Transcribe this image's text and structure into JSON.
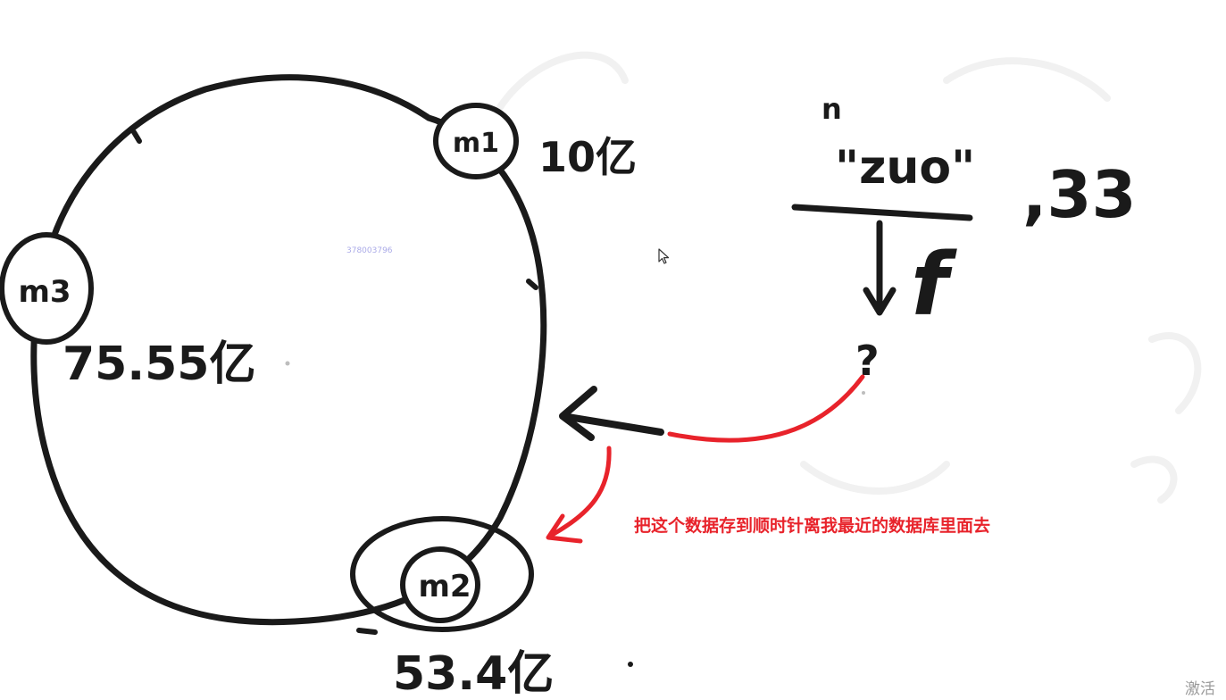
{
  "ring": {
    "nodes": [
      {
        "id": "m1",
        "label": "m1",
        "position_label": "10亿"
      },
      {
        "id": "m2",
        "label": "m2",
        "position_label": "53.4亿"
      },
      {
        "id": "m3",
        "label": "m3",
        "position_label": "75.55亿"
      }
    ]
  },
  "key": {
    "numerator": "\"zuo\"",
    "denominator": "f",
    "exponent": "n",
    "suffix": ",33",
    "result": "?"
  },
  "annotation": {
    "text": "把这个数据存到顺时针离我最近的数据库里面去",
    "color": "#e8232b"
  },
  "watermark": "378003796",
  "activate_text": "激活",
  "colors": {
    "ink": "#1a1a1a",
    "arrow": "#e8232b"
  }
}
